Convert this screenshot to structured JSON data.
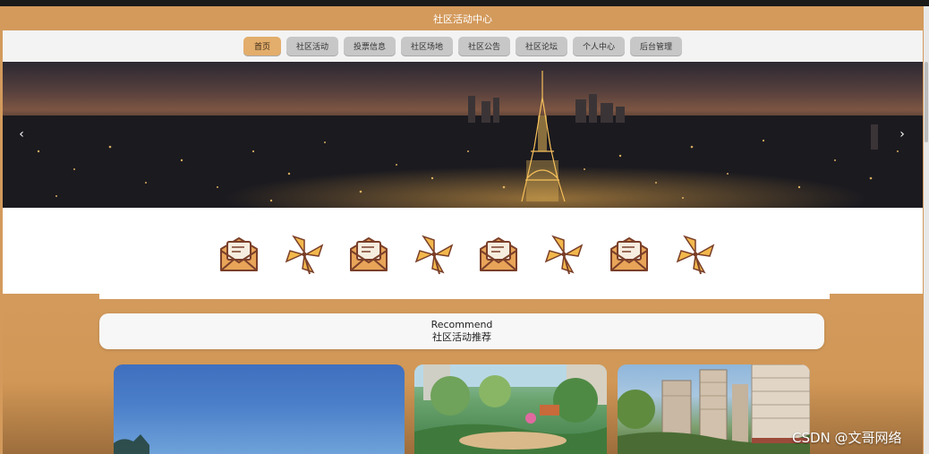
{
  "header": {
    "title": "社区活动中心"
  },
  "nav": {
    "items": [
      {
        "label": "首页",
        "active": true
      },
      {
        "label": "社区活动"
      },
      {
        "label": "投票信息"
      },
      {
        "label": "社区场地"
      },
      {
        "label": "社区公告"
      },
      {
        "label": "社区论坛"
      },
      {
        "label": "个人中心"
      },
      {
        "label": "后台管理"
      }
    ]
  },
  "banner": {
    "prev_icon": "chevron-left-icon",
    "next_icon": "chevron-right-icon"
  },
  "icon_row": [
    "envelope-icon",
    "pinwheel-icon",
    "envelope-icon",
    "pinwheel-icon",
    "envelope-icon",
    "pinwheel-icon",
    "envelope-icon",
    "pinwheel-icon"
  ],
  "recommend": {
    "en": "Recommend",
    "zh": "社区活动推荐"
  },
  "watermark": "CSDN @文哥网络",
  "colors": {
    "accent": "#d39a5c",
    "nav_bg": "#f3f3f3",
    "nav_item": "#c7c7c7",
    "nav_active": "#e3ad6b"
  }
}
